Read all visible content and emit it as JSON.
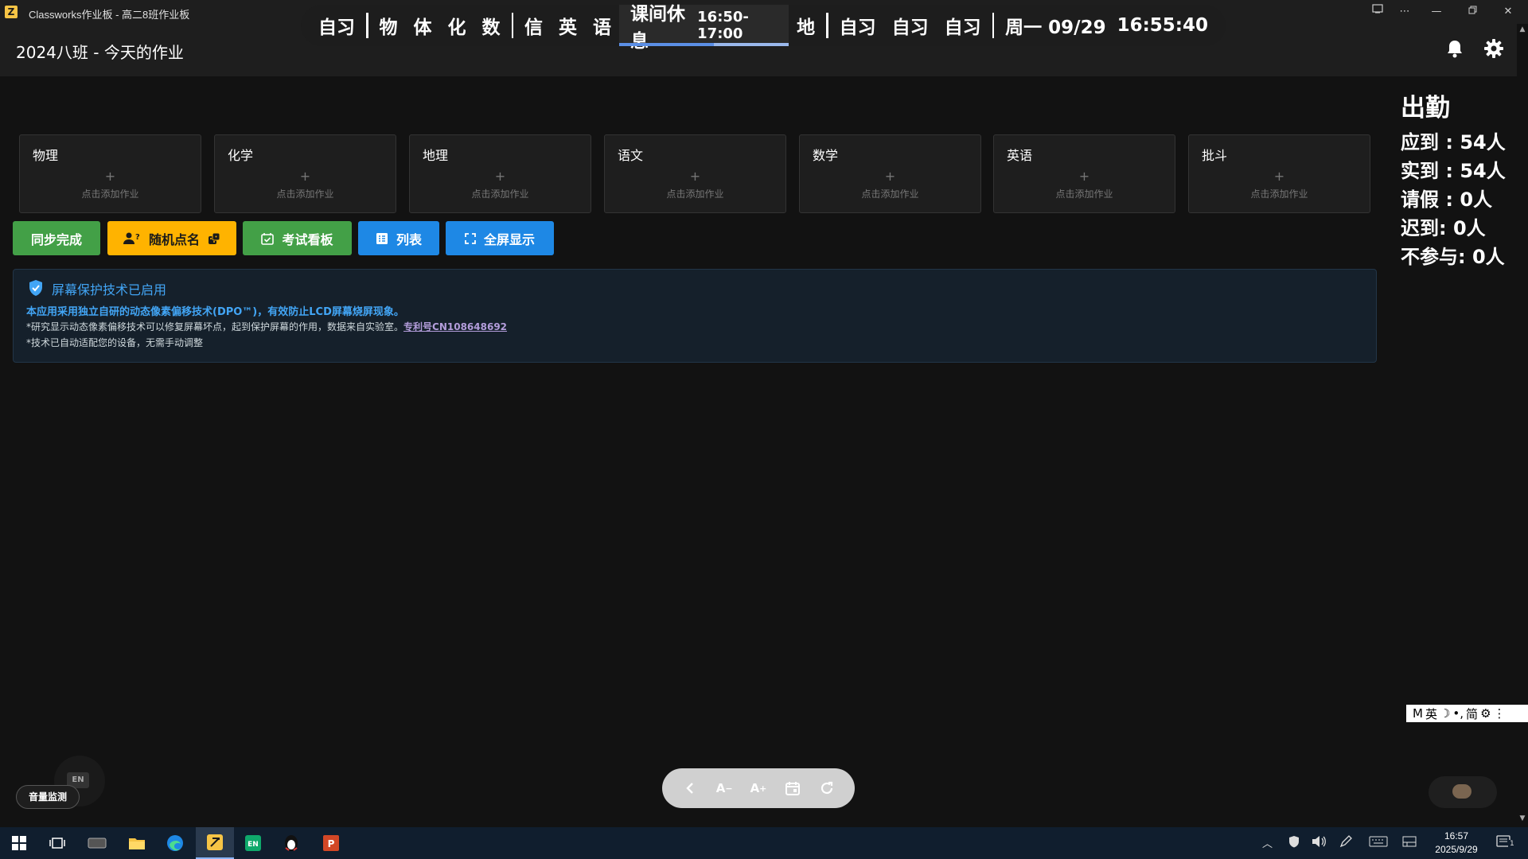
{
  "window": {
    "title": "Classworks作业板 - 高二8班作业板"
  },
  "schedule": {
    "slots_before": [
      "自习",
      "物",
      "体",
      "化",
      "数",
      "信",
      "英",
      "语"
    ],
    "current": {
      "name": "课间休息",
      "time": "16:50-17:00",
      "progress": 0.56
    },
    "slots_after": [
      "地",
      "自习",
      "自习",
      "自习"
    ],
    "date": "周一 09/29",
    "clock": "16:55:40"
  },
  "header": {
    "title": "2024八班 - 今天的作业"
  },
  "subjects": [
    {
      "name": "物理",
      "plus": "+",
      "hint": "点击添加作业"
    },
    {
      "name": "化学",
      "plus": "+",
      "hint": "点击添加作业"
    },
    {
      "name": "地理",
      "plus": "+",
      "hint": "点击添加作业"
    },
    {
      "name": "语文",
      "plus": "+",
      "hint": "点击添加作业"
    },
    {
      "name": "数学",
      "plus": "+",
      "hint": "点击添加作业"
    },
    {
      "name": "英语",
      "plus": "+",
      "hint": "点击添加作业"
    },
    {
      "name": "批斗",
      "plus": "+",
      "hint": "点击添加作业"
    }
  ],
  "actions": {
    "sync": "同步完成",
    "random": "随机点名",
    "exam": "考试看板",
    "list": "列表",
    "fullscreen": "全屏显示",
    "colors": {
      "sync": "#43a047",
      "random": "#ffb300",
      "exam": "#43a047",
      "list": "#1e88e5",
      "fullscreen": "#1e88e5"
    }
  },
  "info": {
    "title": "屏幕保护技术已启用",
    "line1": "本应用采用独立自研的动态像素偏移技术(DPO™)，有效防止LCD屏幕烧屏现象。",
    "line2": "*研究显示动态像素偏移技术可以修复屏幕坏点，起到保护屏幕的作用，数据来自实验室。",
    "patent": "专利号CN108648692",
    "line3": "*技术已自动适配您的设备，无需手动调整"
  },
  "attendance": {
    "title": "出勤",
    "rows": [
      {
        "label": "应到 : ",
        "value": "54人"
      },
      {
        "label": "实到 : ",
        "value": "54人"
      },
      {
        "label": "请假 : ",
        "value": "0人"
      },
      {
        "label": "迟到: ",
        "value": "0人"
      },
      {
        "label": "不参与: ",
        "value": "0人"
      }
    ]
  },
  "ime": {
    "chars": [
      "M",
      "英",
      "☽",
      "•,",
      "简",
      "⚙",
      "⋮"
    ]
  },
  "widgets": {
    "volume_label": "音量监测",
    "en_badge": "EN"
  },
  "toolbar": {
    "font_down": "A",
    "font_up": "A"
  },
  "taskbar": {
    "time": "16:57",
    "date": "2025/9/29",
    "notification_count": "1"
  }
}
